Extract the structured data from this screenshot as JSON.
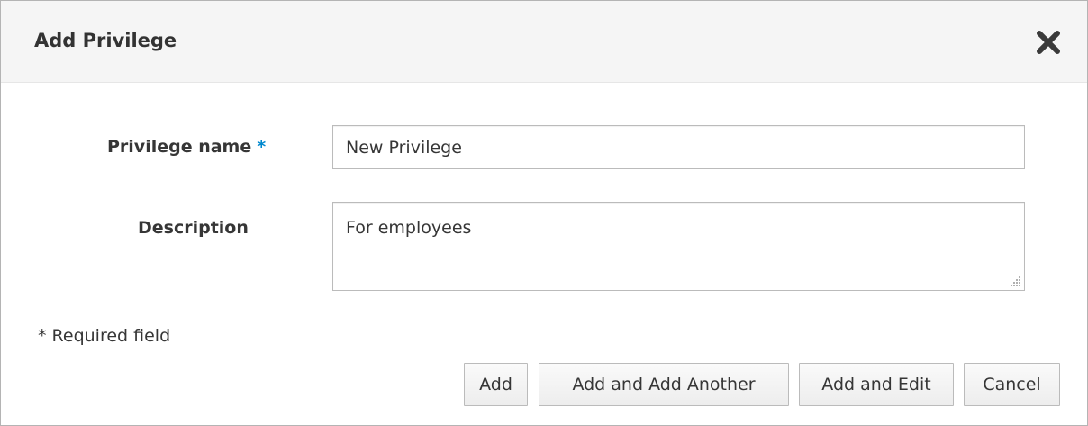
{
  "dialog": {
    "title": "Add Privilege",
    "close_icon": "close-icon"
  },
  "form": {
    "name_label": "Privilege name",
    "required_marker": "*",
    "name_value": "New Privilege",
    "description_label": "Description",
    "description_value": "For employees",
    "required_note": "* Required field"
  },
  "buttons": {
    "add": "Add",
    "add_another": "Add and Add Another",
    "add_edit": "Add and Edit",
    "cancel": "Cancel"
  },
  "colors": {
    "accent": "#0088ce",
    "header_bg": "#f5f5f5",
    "text": "#363636"
  }
}
